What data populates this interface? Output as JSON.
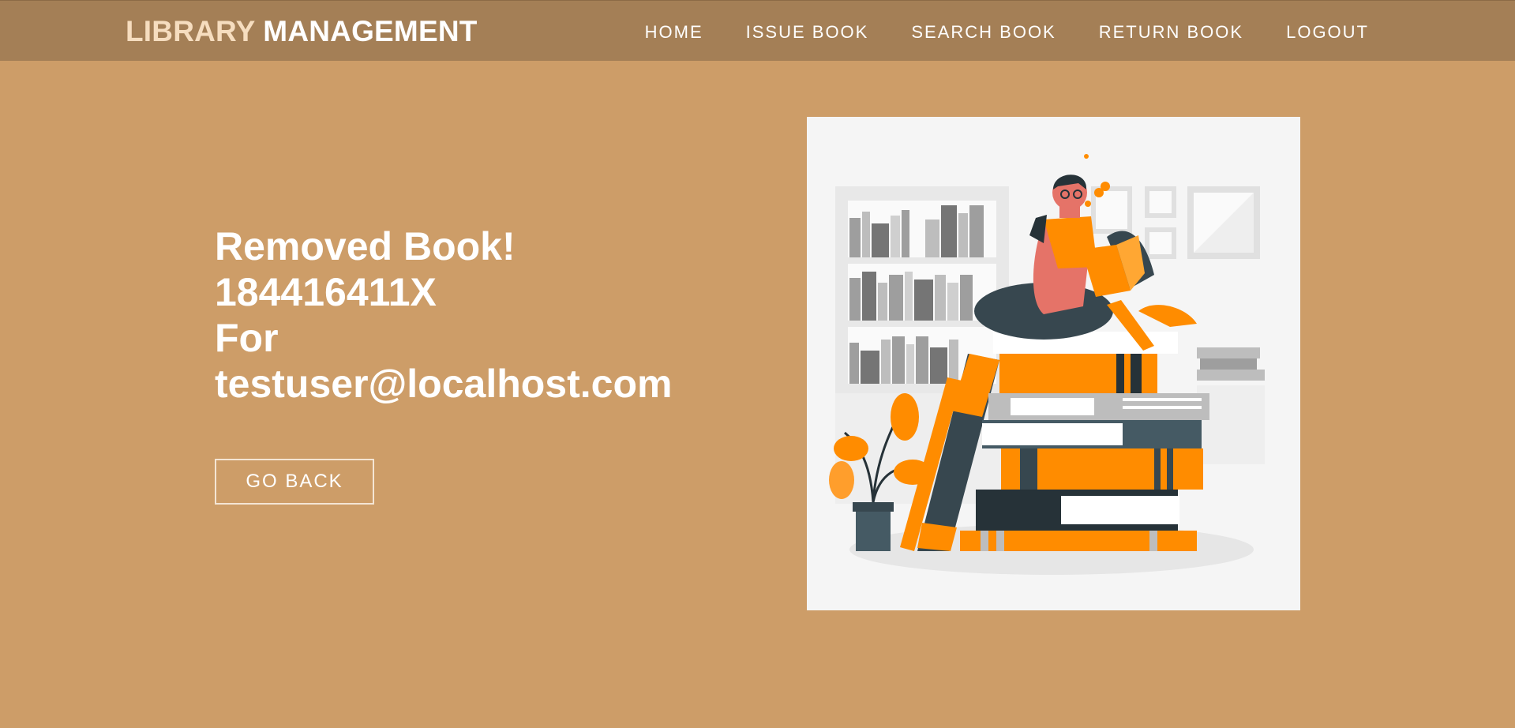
{
  "header": {
    "brand_part1": "LIBRARY",
    "brand_part2": "MANAGEMENT",
    "nav": [
      {
        "label": "HOME"
      },
      {
        "label": "ISSUE BOOK"
      },
      {
        "label": "SEARCH BOOK"
      },
      {
        "label": "RETURN BOOK"
      },
      {
        "label": "LOGOUT"
      }
    ]
  },
  "main": {
    "message_lines": [
      "Removed Book!",
      "184416411X",
      "For",
      "testuser@localhost.com"
    ],
    "go_back_label": "GO BACK",
    "illustration": {
      "icon": "reading-person-on-book-stack-illustration"
    }
  },
  "colors": {
    "background": "#cd9d68",
    "navbar": "#a47f56",
    "brand_accent": "#f6ddbf",
    "text": "#ffffff",
    "illustration_orange": "#ff8c00",
    "illustration_dark": "#37474f"
  }
}
